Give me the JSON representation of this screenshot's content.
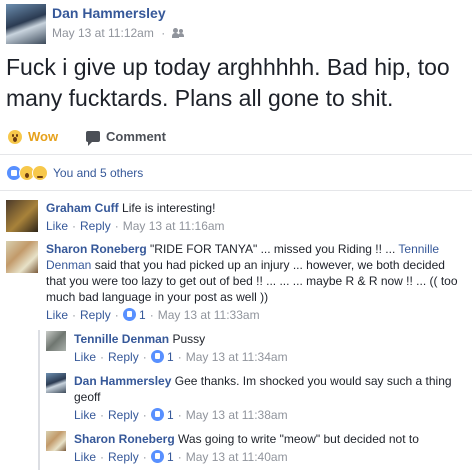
{
  "post": {
    "author": "Dan Hammersley",
    "timestamp": "May 13 at 11:12am",
    "separator": "·",
    "audience_icon": "friends-icon",
    "text": "Fuck i give up today arghhhhh. Bad hip, too many fucktards. Plans all gone to shit."
  },
  "actions": {
    "wow_label": "Wow",
    "comment_label": "Comment"
  },
  "reactions": {
    "summary": "You and 5 others",
    "icons": [
      "like-icon",
      "wow-icon",
      "sad-icon"
    ]
  },
  "comments": [
    {
      "author": "Graham Cuff",
      "text": "Life is interesting!",
      "like": "Like",
      "reply": "Reply",
      "time": "May 13 at 11:16am"
    },
    {
      "author": "Sharon Roneberg",
      "text_before": "\"RIDE FOR TANYA\" ... missed you Riding !! ... ",
      "mention": "Tennille Denman",
      "text_after": " said that you had picked up an injury ... however, we both decided that you were too lazy to get out of bed !! ... ... ... maybe R & R now !! ... (( too much bad language in your post as well ))",
      "like": "Like",
      "reply": "Reply",
      "likes": "1",
      "time": "May 13 at 11:33am"
    }
  ],
  "replies": [
    {
      "author": "Tennille Denman",
      "text": "Pussy",
      "like": "Like",
      "reply": "Reply",
      "likes": "1",
      "time": "May 13 at 11:34am"
    },
    {
      "author": "Dan Hammersley",
      "text": "Gee thanks. Im shocked you would say such a thing geoff",
      "like": "Like",
      "reply": "Reply",
      "likes": "1",
      "time": "May 13 at 11:38am"
    },
    {
      "author": "Sharon Roneberg",
      "text": "Was going to write \"meow\" but decided not to",
      "like": "Like",
      "reply": "Reply",
      "likes": "1",
      "time": "May 13 at 11:40am"
    }
  ],
  "colors": {
    "link": "#365899",
    "meta": "#90949c",
    "wow": "#e6a11b",
    "like_badge": "#5890ff"
  }
}
